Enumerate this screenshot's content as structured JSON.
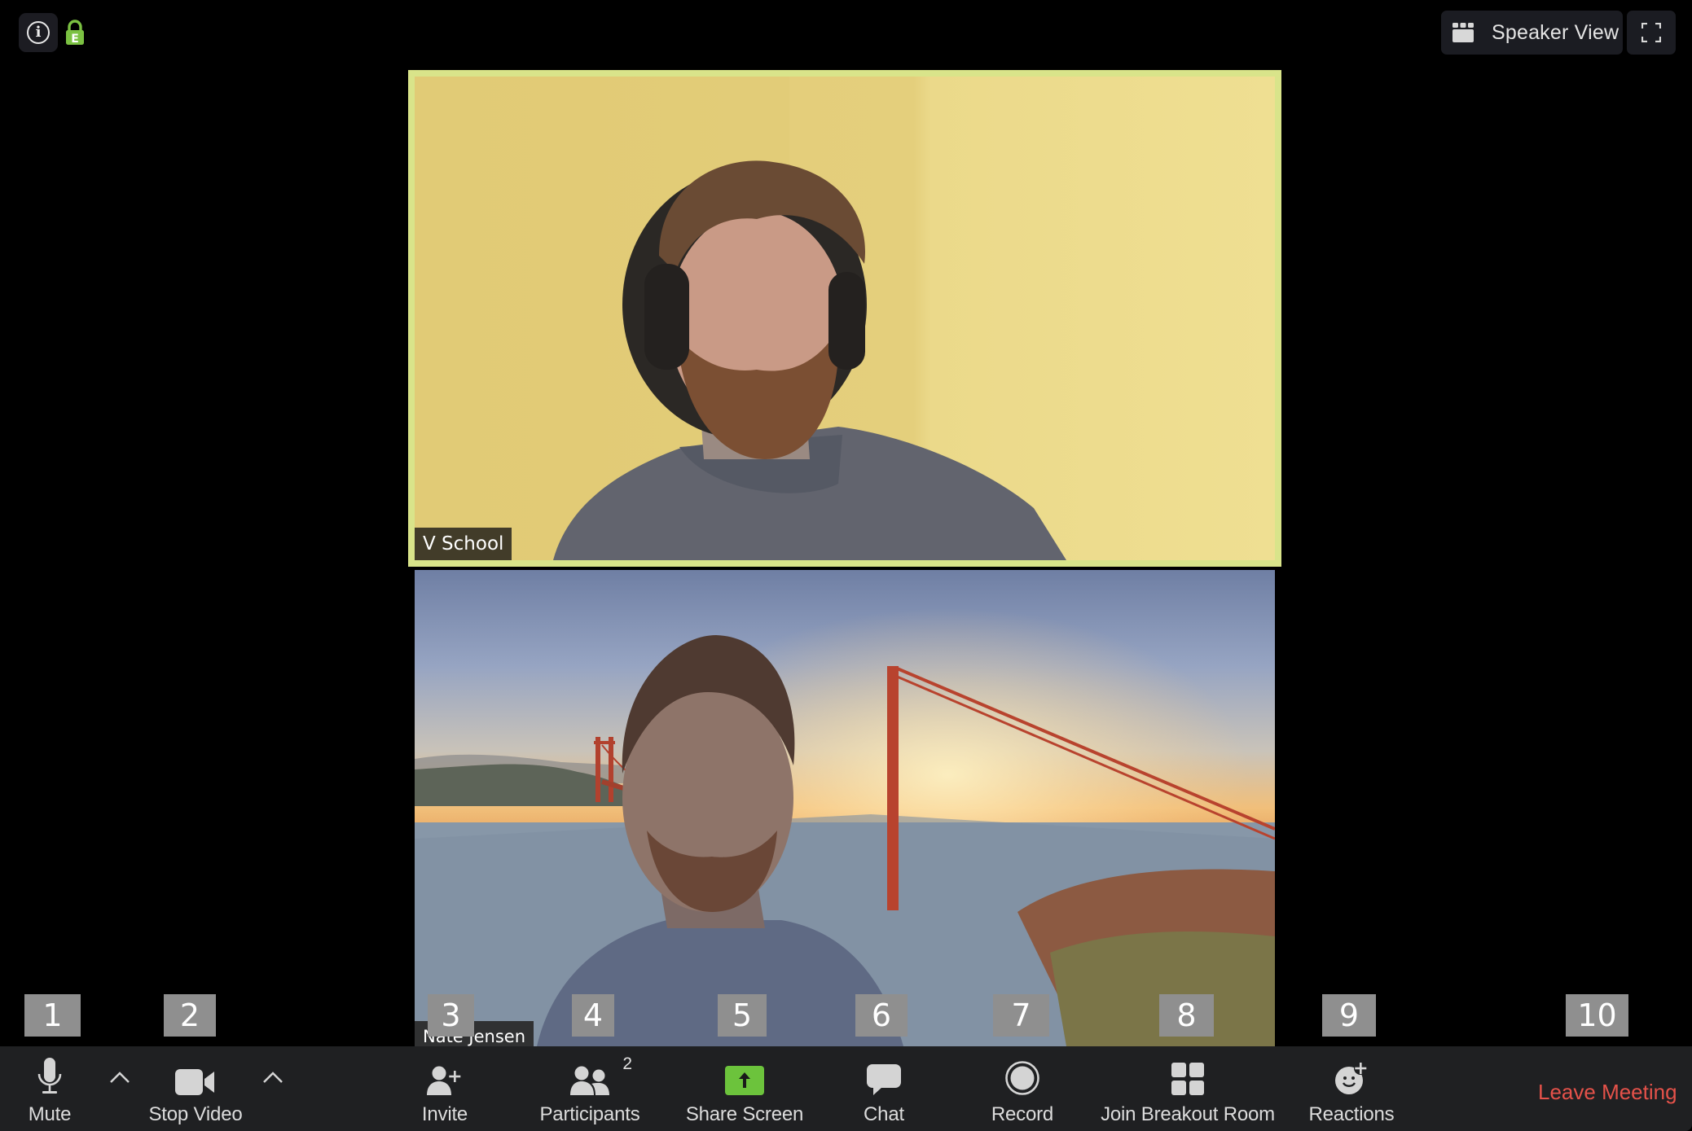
{
  "window": {
    "view_mode_label": "Speaker View",
    "encryption_badge": "E",
    "colors": {
      "active_speaker_border": "#d9e48a",
      "share_green": "#6cc33c",
      "lock_green": "#7bc142",
      "leave_red": "#e5524a",
      "toolbar_bg": "#1f2022"
    }
  },
  "icons": {
    "info": "info-icon",
    "lock": "encryption-lock-icon",
    "speaker_view": "grid-view-icon",
    "fullscreen": "fullscreen-icon"
  },
  "videos": [
    {
      "participant_name": "V School",
      "active_speaker": true
    },
    {
      "participant_name": "Nate Jensen",
      "active_speaker": false
    }
  ],
  "overlay_numbers": [
    "1",
    "2",
    "3",
    "4",
    "5",
    "6",
    "7",
    "8",
    "9",
    "10"
  ],
  "toolbar": {
    "items": [
      {
        "label": "Mute",
        "icon": "microphone-icon"
      },
      {
        "label": "Stop Video",
        "icon": "video-camera-icon"
      },
      {
        "label": "Invite",
        "icon": "add-person-icon"
      },
      {
        "label": "Participants",
        "icon": "participants-icon",
        "count": "2"
      },
      {
        "label": "Share Screen",
        "icon": "share-screen-icon"
      },
      {
        "label": "Chat",
        "icon": "chat-bubble-icon"
      },
      {
        "label": "Record",
        "icon": "record-icon"
      },
      {
        "label": "Join Breakout Room",
        "icon": "breakout-grid-icon"
      },
      {
        "label": "Reactions",
        "icon": "reactions-smiley-icon"
      }
    ],
    "leave_label": "Leave Meeting"
  }
}
